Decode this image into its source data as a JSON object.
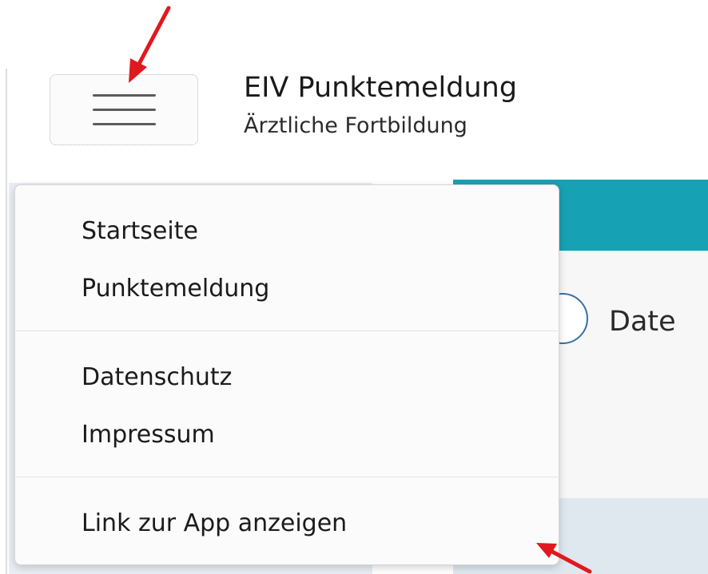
{
  "header": {
    "title": "EIV Punktemeldung",
    "subtitle": "Ärztliche Fortbildung",
    "menu_icon": "hamburger-menu-icon"
  },
  "background": {
    "radio_label": "Date"
  },
  "menu": {
    "items": [
      {
        "label": "Startseite"
      },
      {
        "label": "Punktemeldung"
      },
      {
        "label": "Datenschutz"
      },
      {
        "label": "Impressum"
      },
      {
        "label": "Link zur App anzeigen"
      }
    ]
  },
  "colors": {
    "accent_teal": "#17a1b4",
    "annotation_red": "#e0191e"
  }
}
